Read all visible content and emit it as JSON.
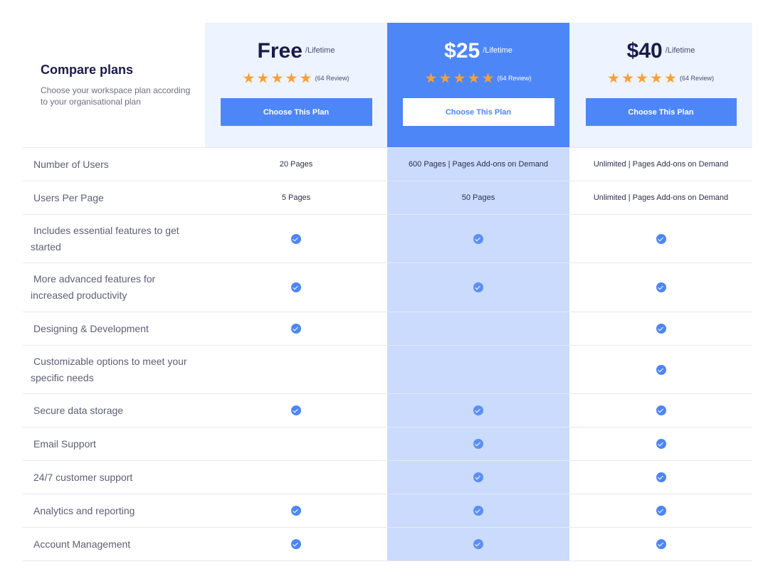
{
  "intro": {
    "title": "Compare plans",
    "subtitle": "Choose your workspace plan according to your organisational plan"
  },
  "plans": [
    {
      "price": "Free",
      "period": "/Lifetime",
      "stars": 5,
      "reviews": "(64 Review)",
      "button": "Choose This Plan"
    },
    {
      "price": "$25",
      "period": "/Lifetime",
      "stars": 5,
      "reviews": "(64 Review)",
      "button": "Choose This Plan",
      "highlighted": true
    },
    {
      "price": "$40",
      "period": "/Lifetime",
      "stars": 5,
      "reviews": "(64 Review)",
      "button": "Choose This Plan"
    }
  ],
  "rows": [
    {
      "label": "Number of Users",
      "values": [
        "20 Pages",
        "600 Pages | Pages Add-ons on Demand",
        "Unlimited | Pages Add-ons on Demand"
      ]
    },
    {
      "label": "Users Per Page",
      "values": [
        "5 Pages",
        "50 Pages",
        "Unlimited | Pages Add-ons on Demand"
      ]
    },
    {
      "label": "Includes essential features to get started",
      "checks": [
        true,
        true,
        true
      ]
    },
    {
      "label": "More advanced features for increased productivity",
      "checks": [
        true,
        true,
        true
      ]
    },
    {
      "label": "Designing & Development",
      "checks": [
        true,
        false,
        true
      ]
    },
    {
      "label": "Customizable options to meet your specific needs",
      "checks": [
        false,
        false,
        true
      ]
    },
    {
      "label": "Secure data storage",
      "checks": [
        true,
        true,
        true
      ]
    },
    {
      "label": "Email Support",
      "checks": [
        false,
        true,
        true
      ]
    },
    {
      "label": "24/7 customer support",
      "checks": [
        false,
        true,
        true
      ]
    },
    {
      "label": "Analytics and reporting",
      "checks": [
        true,
        true,
        true
      ]
    },
    {
      "label": "Account Management",
      "checks": [
        true,
        true,
        true
      ]
    }
  ],
  "colors": {
    "accent": "#4d86f7",
    "highlight_column": "#cadbfe",
    "plan_header_bg": "#edf3ff",
    "star": "#f8a034",
    "title": "#1a1b4b"
  },
  "icons": {
    "star": "star-icon",
    "included": "check-circle-icon"
  }
}
